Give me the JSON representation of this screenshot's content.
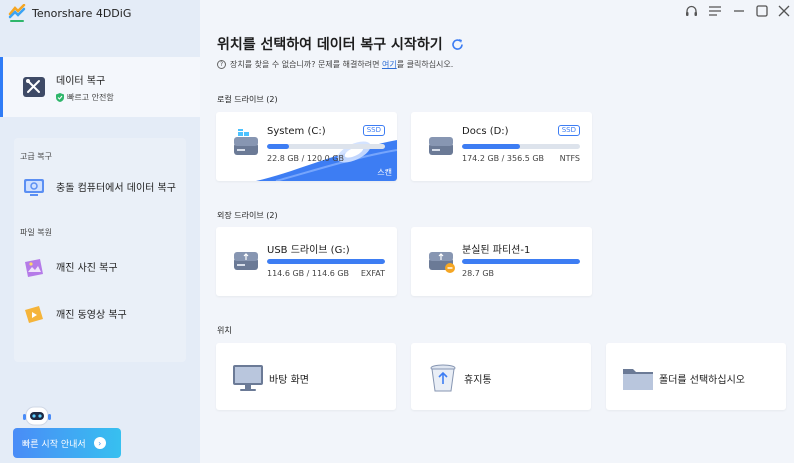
{
  "app": {
    "name": "Tenorshare 4DDiG"
  },
  "sidebar": {
    "active_item": {
      "title": "데이터 복구",
      "subtitle": "빠르고 안전함"
    },
    "advanced_label": "고급 복구",
    "crash_computer": "충돌 컴퓨터에서 데이터 복구",
    "file_repair_label": "파일 복원",
    "broken_photo": "깨진 사진 복구",
    "broken_video": "깨진 동영상 복구",
    "quick_start": "빠른 시작 안내서"
  },
  "main": {
    "title": "위치를 선택하여 데이터 복구 시작하기",
    "help_prefix": "장치를 찾을 수 없습니까? 문제를 해결하려면 ",
    "help_link": "여기",
    "help_suffix": "를 클릭하십시오.",
    "local_drives_label": "로컬 드라이브 (2)",
    "external_drives_label": "외장 드라이브 (2)",
    "location_label": "위치"
  },
  "drives": [
    {
      "name": "System (C:)",
      "size": "22.8 GB / 120.0 GB",
      "badge": "SSD",
      "fs": "",
      "used_fraction": 0.19,
      "scan_label": "스캔"
    },
    {
      "name": "Docs (D:)",
      "size": "174.2 GB / 356.5 GB",
      "badge": "SSD",
      "fs": "NTFS",
      "used_fraction": 0.49
    },
    {
      "name": "USB 드라이브 (G:)",
      "size": "114.6 GB / 114.6 GB",
      "badge": "",
      "fs": "EXFAT",
      "used_fraction": 1.0
    },
    {
      "name": "분실된 파티션-1",
      "size": "28.7 GB",
      "badge": "",
      "fs": "",
      "used_fraction": 1.0
    }
  ],
  "locations": [
    {
      "name": "바탕 화면",
      "icon": "monitor-icon"
    },
    {
      "name": "휴지통",
      "icon": "recycle-bin-icon"
    },
    {
      "name": "폴더를 선택하십시오",
      "icon": "folder-icon"
    }
  ],
  "colors": {
    "accent": "#3d7df3",
    "sidebar_bg": "#e4ecf7",
    "main_bg": "#f2f5fa"
  }
}
